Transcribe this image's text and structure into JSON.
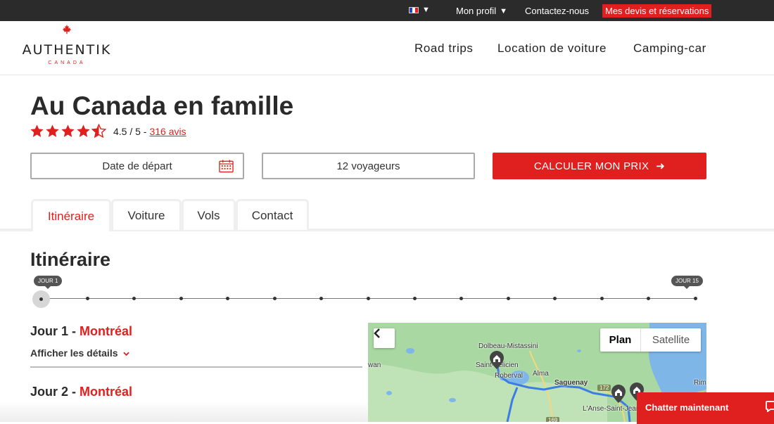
{
  "topbar": {
    "language_caret": "▼",
    "profile_label": "Mon profil",
    "profile_caret": "▼",
    "contact_label": "Contactez-nous",
    "quotes_label": "Mes devis et réservations"
  },
  "header": {
    "logo_main": "AUTHENTIK",
    "logo_sub": "CANADA",
    "nav": [
      "Road trips",
      "Location de voiture",
      "Camping-car"
    ]
  },
  "product": {
    "title": "Au Canada en famille",
    "rating_value": 4.5,
    "rating_text": "4.5 / 5 -",
    "reviews_link": "316 avis"
  },
  "booking": {
    "date_label": "Date de départ",
    "travelers_label": "12 voyageurs",
    "cta_label": "CALCULER MON PRIX",
    "cta_arrow": "➜"
  },
  "tabs": [
    "Itinéraire",
    "Voiture",
    "Vols",
    "Contact"
  ],
  "itinerary": {
    "heading": "Itinéraire",
    "first_day_label": "JOUR 1",
    "last_day_label": "JOUR 15",
    "day_count": 15,
    "days": [
      {
        "prefix": "Jour 1 -",
        "city": "Montréal"
      },
      {
        "prefix": "Jour 2 -",
        "city": "Montréal"
      }
    ],
    "details_label": "Afficher les détails",
    "details_chevron": "˅"
  },
  "map": {
    "back_glyph": "‹",
    "plan_label": "Plan",
    "satellite_label": "Satellite",
    "labels": {
      "dolbeau": "Dolbeau-Mistassini",
      "felicien": "Saint-Félicien",
      "roberval": "Roberval",
      "alma": "Alma",
      "saguenay": "Saguenay",
      "anse": "L'Anse-Saint-Jean",
      "wan": "wan",
      "rim": "Rim"
    },
    "road_signs": {
      "r172": "172",
      "r169": "169"
    }
  },
  "chat": {
    "label": "Chatter maintenant"
  },
  "colors": {
    "accent": "#e0201e",
    "topbar": "#2b2b2b"
  }
}
